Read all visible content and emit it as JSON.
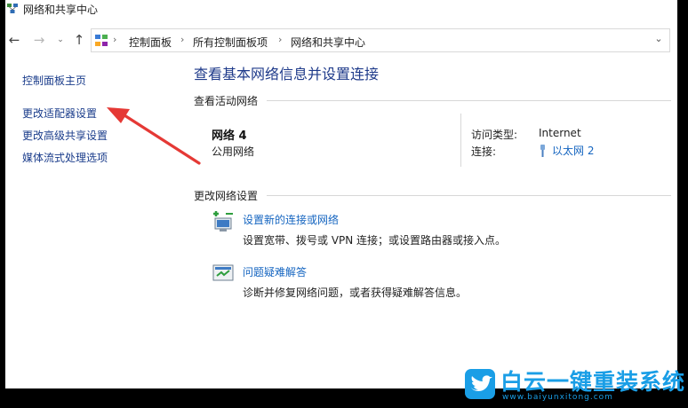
{
  "window": {
    "title": "网络和共享中心"
  },
  "addressbar": {
    "back": "←",
    "forward": "→",
    "dropdown": "⌄",
    "up": "↑",
    "breadcrumbs": [
      "控制面板",
      "所有控制面板项",
      "网络和共享中心"
    ],
    "separator": "›",
    "expand": "⌄"
  },
  "sidebar": {
    "items": [
      {
        "label": "控制面板主页"
      },
      {
        "label": "更改适配器设置"
      },
      {
        "label": "更改高级共享设置"
      },
      {
        "label": "媒体流式处理选项"
      }
    ]
  },
  "main": {
    "title": "查看基本网络信息并设置连接",
    "active_section": "查看活动网络",
    "network": {
      "name": "网络 4",
      "category": "公用网络",
      "access_type_label": "访问类型:",
      "access_type_value": "Internet",
      "connection_label": "连接:",
      "connection_value": "以太网 2"
    },
    "change_section": "更改网络设置",
    "tasks": [
      {
        "link": "设置新的连接或网络",
        "desc": "设置宽带、拨号或 VPN 连接；或设置路由器或接入点。",
        "icon": "network-setup-icon"
      },
      {
        "link": "问题疑难解答",
        "desc": "诊断并修复网络问题，或者获得疑难解答信息。",
        "icon": "troubleshoot-icon"
      }
    ]
  },
  "annotation": {
    "color": "#e53935"
  },
  "watermark": {
    "brand": "白云一键重装系统",
    "url": "www.baiyunxitong.com",
    "color": "#1a9ee6",
    "icon": "bird-logo-icon"
  }
}
